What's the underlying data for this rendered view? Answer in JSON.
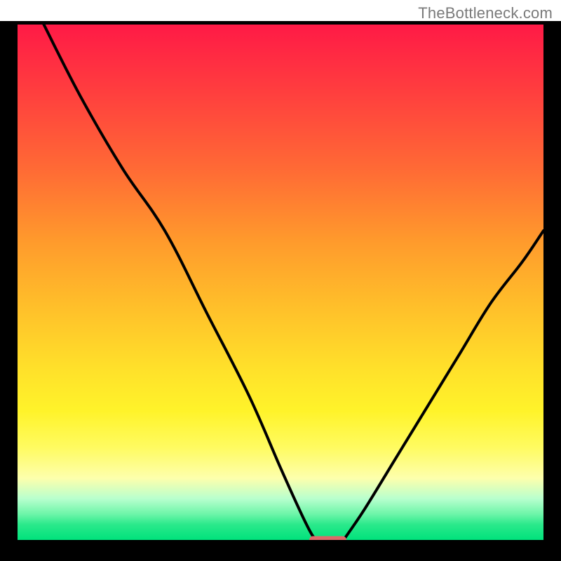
{
  "attribution": "TheBottleneck.com",
  "chart_data": {
    "type": "line",
    "title": "",
    "xlabel": "",
    "ylabel": "",
    "xlim": [
      0,
      100
    ],
    "ylim": [
      0,
      100
    ],
    "grid": false,
    "legend": false,
    "series": [
      {
        "name": "left-curve",
        "x": [
          5,
          12,
          20,
          28,
          36,
          44,
          50,
          54,
          56,
          57
        ],
        "values": [
          100,
          86,
          72,
          60,
          44,
          28,
          14,
          5,
          1,
          0
        ]
      },
      {
        "name": "right-curve",
        "x": [
          62,
          66,
          72,
          78,
          84,
          90,
          96,
          100
        ],
        "values": [
          0,
          6,
          16,
          26,
          36,
          46,
          54,
          60
        ]
      }
    ],
    "notch": {
      "x_center": 59,
      "width": 7
    }
  },
  "colors": {
    "bg": "#000000",
    "curve": "#000000",
    "notch": "#db6a6a",
    "attrib": "#7a7a7a"
  }
}
